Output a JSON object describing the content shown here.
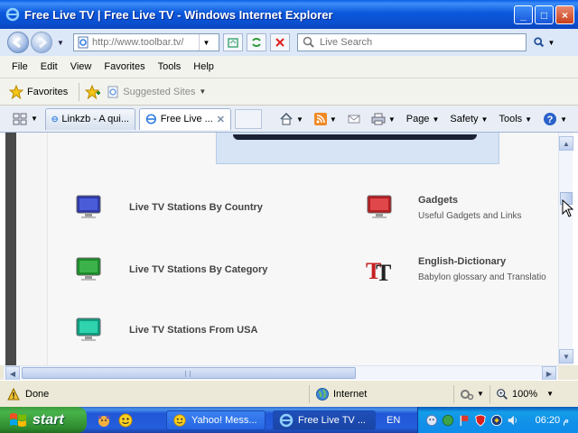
{
  "window": {
    "title": "Free Live TV | Free Live TV - Windows Internet Explorer",
    "controls": [
      "_",
      "□",
      "×"
    ]
  },
  "address": {
    "url": "http://www.toolbar.tv/",
    "search_placeholder": "Live Search"
  },
  "menu": [
    "File",
    "Edit",
    "View",
    "Favorites",
    "Tools",
    "Help"
  ],
  "favorites": {
    "label": "Favorites",
    "suggested": "Suggested Sites"
  },
  "tabs": [
    {
      "label": "Linkzb - A qui..."
    },
    {
      "label": "Free Live ..."
    }
  ],
  "commands": {
    "page": "Page",
    "safety": "Safety",
    "tools": "Tools"
  },
  "content": {
    "left": [
      "Live TV Stations By Country",
      "Live TV Stations By Category",
      "Live TV Stations From USA"
    ],
    "right": [
      {
        "title": "Gadgets",
        "subtitle": "Useful Gadgets and Links"
      },
      {
        "title": "English-Dictionary",
        "subtitle": "Babylon glossary and Translatio"
      }
    ]
  },
  "status": {
    "text": "Done",
    "zone": "Internet",
    "zoom": "100%"
  },
  "taskbar": {
    "start": "start",
    "tasks": [
      "Yahoo! Mess...",
      "Free Live TV ..."
    ],
    "language": "EN",
    "clock": "06:20 م"
  },
  "colors": {
    "title_bar": "#0A4FCF",
    "start_green": "#3C9B3C",
    "tray_blue": "#1290E8"
  }
}
